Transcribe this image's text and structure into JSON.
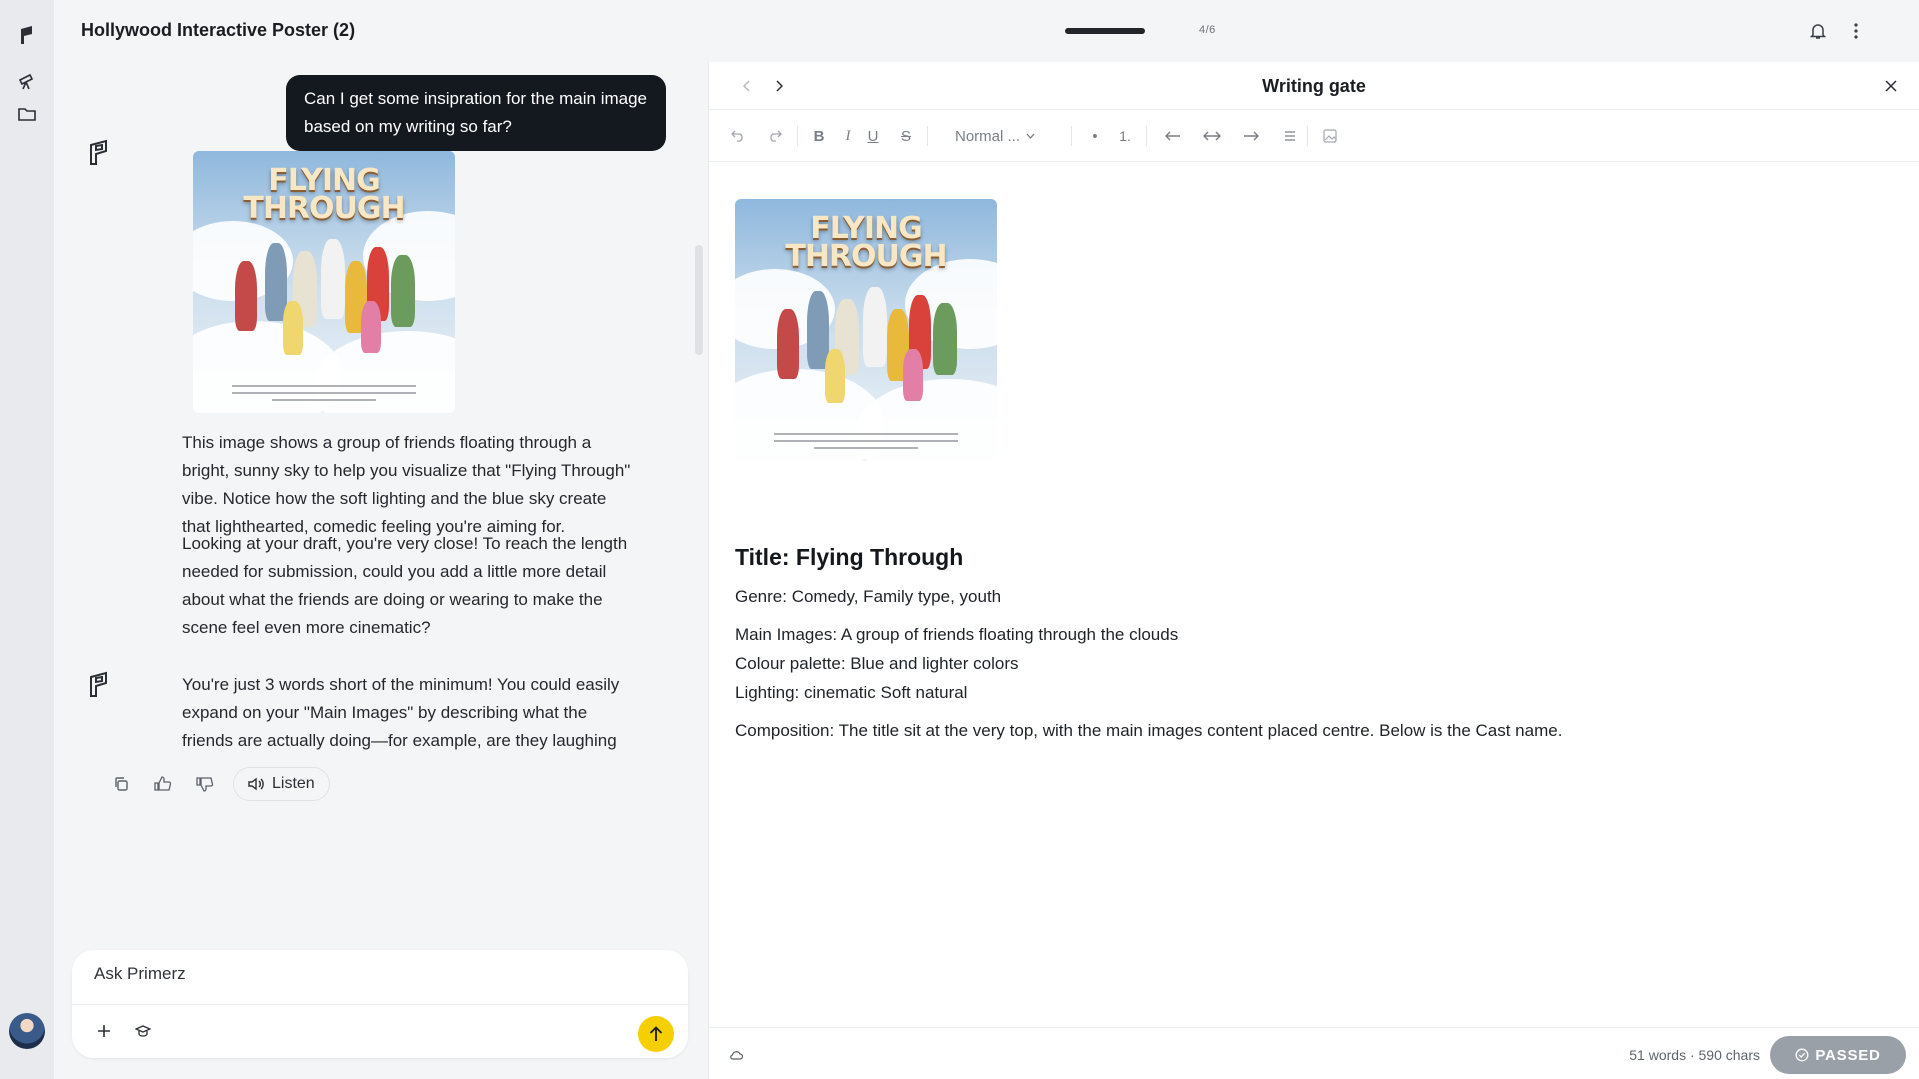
{
  "header": {
    "title": "Hollywood Interactive Poster (2)",
    "progress_label": "4/6",
    "progress_fraction": 0.667
  },
  "chat": {
    "user_message": "Can I get some insipration for the main image based on my writing so far?",
    "image_title_line1": "FLYING",
    "image_title_line2": "THROUGH",
    "assistant_p1": "This image shows a group of friends floating through a bright, sunny sky to help you visualize that \"Flying Through\" vibe. Notice how the soft lighting and the blue sky create that lighthearted, comedic feeling you're aiming for.",
    "assistant_p2": "Looking at your draft, you're very close! To reach the length needed for submission, could you add a little more detail about what the friends are doing or wearing to make the scene feel even more cinematic?",
    "listen_label": "Listen",
    "assistant_msg2": "You're just 3 words short of the minimum! You could easily expand on your \"Main Images\" by describing what the friends are actually doing—for example, are they laughing or reaching for something in the clouds? You're so close to being ready to",
    "composer_placeholder": "Ask Primerz"
  },
  "editor": {
    "title": "Writing gate",
    "style_select": "Normal ...",
    "doc_title": "Title: Flying Through",
    "line_genre": "Genre: Comedy, Family type, youth",
    "line_main_images": "Main Images: A group of friends floating through the clouds",
    "line_palette": "Colour palette: Blue and lighter colors",
    "line_lighting": "Lighting: cinematic Soft natural",
    "line_composition": "Composition: The title sit at the very top, with the main images content placed centre. Below is the Cast name.",
    "counts": "51 words · 590 chars",
    "status_label": "PASSED"
  },
  "colors": {
    "accent_send": "#f5cf00",
    "user_bubble": "#14181f",
    "passed_badge": "#9aa0a8"
  }
}
